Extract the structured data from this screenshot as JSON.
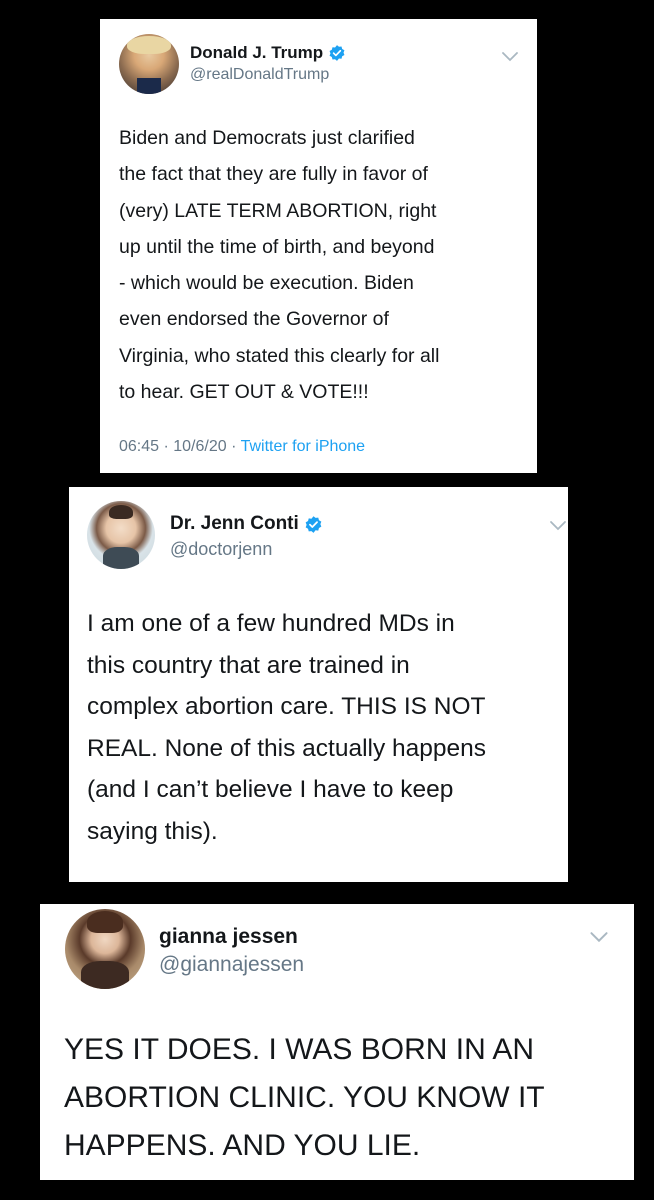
{
  "tweets": [
    {
      "name": "Donald J. Trump",
      "handle": "@realDonaldTrump",
      "verified": true,
      "icon": "verified-badge-icon",
      "text": "Biden and Democrats just clarified\nthe fact that they are fully in favor of\n(very) LATE TERM ABORTION, right\nup until the time of birth, and beyond\n- which would be execution. Biden\neven endorsed the Governor of\nVirginia, who stated this clearly for all\nto hear. GET OUT & VOTE!!!",
      "time": "06:45 · 10/6/20 · ",
      "source": "Twitter for iPhone"
    },
    {
      "name": "Dr. Jenn Conti",
      "handle": "@doctorjenn",
      "verified": true,
      "icon": "verified-badge-icon",
      "text": "I am one of a few hundred MDs in\nthis country that are trained in\ncomplex abortion care. THIS IS NOT\nREAL. None of this actually happens\n(and I can’t believe I have to keep\nsaying this)."
    },
    {
      "name": "gianna jessen",
      "handle": "@giannajessen",
      "verified": false,
      "text": "YES IT DOES. I WAS BORN IN AN\nABORTION CLINIC. YOU KNOW IT\nHAPPENS. AND YOU LIE."
    }
  ],
  "colors": {
    "background": "#000000",
    "card": "#ffffff",
    "verified": "#1da1f2",
    "handle": "#657786",
    "link": "#1da1f2",
    "text": "#14171a"
  },
  "icons": [
    "avatar",
    "verified-badge-icon",
    "chevron-down-icon"
  ]
}
